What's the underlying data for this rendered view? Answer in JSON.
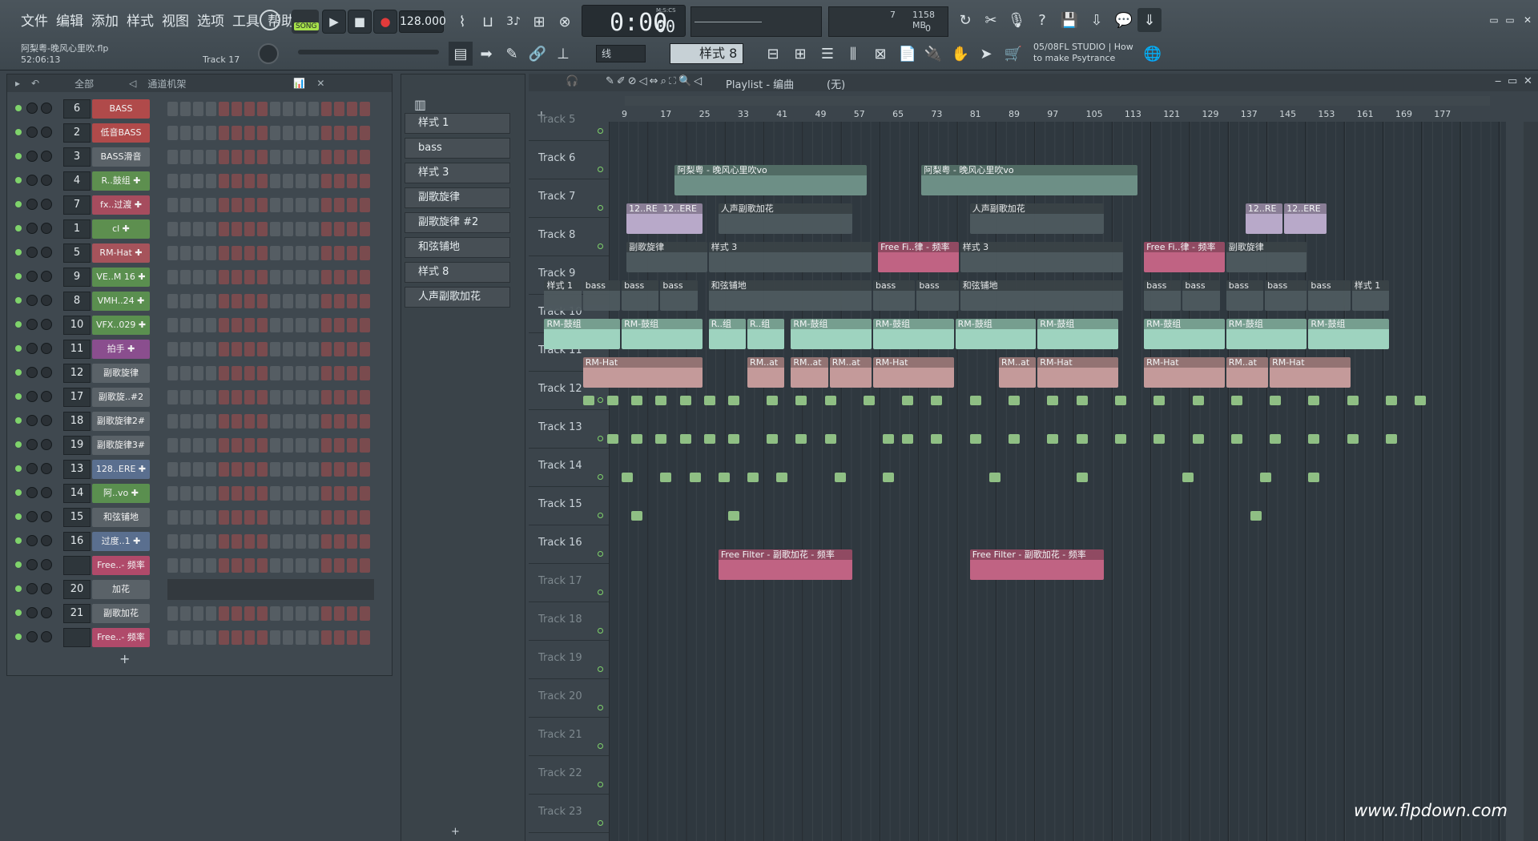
{
  "menu": [
    "文件",
    "编辑",
    "添加",
    "样式",
    "视图",
    "选项",
    "工具",
    "帮助"
  ],
  "song_mode": "SONG",
  "tempo": "128.000",
  "time": "0:00",
  "time_sub": "00",
  "time_unit": "M:S:CS",
  "cpu": "7",
  "ram": "1158 MB",
  "poly": "0",
  "project": {
    "file": "阿梨粤-晚风心里吹.flp",
    "time": "52:06:13",
    "track": "Track 17"
  },
  "pattern_selector": "样式 8",
  "snap": "线",
  "news": {
    "date": "05/08",
    "text1": "FL STUDIO | How",
    "text2": "to make Psytrance"
  },
  "rack": {
    "filter": "全部",
    "title": "通道机架",
    "channels": [
      {
        "num": "6",
        "name": "BASS",
        "color": "#b04a4a"
      },
      {
        "num": "2",
        "name": "低音BASS",
        "color": "#b04a4a"
      },
      {
        "num": "3",
        "name": "BASS滑音",
        "color": "#5a6268"
      },
      {
        "num": "4",
        "name": "R..鼓组 ✚",
        "color": "#5d8f4f"
      },
      {
        "num": "7",
        "name": "fx..过渡 ✚",
        "color": "#a64c5e"
      },
      {
        "num": "1",
        "name": "cl ✚",
        "color": "#5d8f4f"
      },
      {
        "num": "5",
        "name": "RM-Hat ✚",
        "color": "#a6535b"
      },
      {
        "num": "9",
        "name": "VE..M 16 ✚",
        "color": "#5a8f4f"
      },
      {
        "num": "8",
        "name": "VMH..24 ✚",
        "color": "#5a8f4f"
      },
      {
        "num": "10",
        "name": "VFX..029 ✚",
        "color": "#5a8f4f"
      },
      {
        "num": "11",
        "name": "拍手 ✚",
        "color": "#8a4e8e"
      },
      {
        "num": "12",
        "name": "副歌旋律",
        "color": "#5a6268"
      },
      {
        "num": "17",
        "name": "副歌旋..#2",
        "color": "#5a6268"
      },
      {
        "num": "18",
        "name": "副歌旋律2#",
        "color": "#5a6268"
      },
      {
        "num": "19",
        "name": "副歌旋律3#",
        "color": "#5a6268"
      },
      {
        "num": "13",
        "name": "128..ERE ✚",
        "color": "#5a6f8f"
      },
      {
        "num": "14",
        "name": "阿..vo ✚",
        "color": "#5a8f4f"
      },
      {
        "num": "15",
        "name": "和弦铺地",
        "color": "#5a6268"
      },
      {
        "num": "16",
        "name": "过度..1 ✚",
        "color": "#5a6f8f"
      },
      {
        "num": "",
        "name": "Free..- 频率",
        "color": "#b04a6a"
      },
      {
        "num": "20",
        "name": "加花",
        "color": "#5a6268"
      },
      {
        "num": "21",
        "name": "副歌加花",
        "color": "#5a6268"
      },
      {
        "num": "",
        "name": "Free..- 频率",
        "color": "#b04a6a"
      }
    ]
  },
  "patterns": [
    "样式 1",
    "bass",
    "样式 3",
    "副歌旋律",
    "副歌旋律 #2",
    "和弦铺地",
    "样式 8",
    "人声副歌加花"
  ],
  "playlist": {
    "title": "Playlist - 编曲",
    "sub": "(无)",
    "ruler": [
      "9",
      "17",
      "25",
      "33",
      "41",
      "49",
      "57",
      "65",
      "73",
      "81",
      "89",
      "97",
      "105",
      "113",
      "121",
      "129",
      "137",
      "145",
      "153",
      "161",
      "169",
      "177"
    ],
    "tracks": [
      "Track 5",
      "Track 6",
      "Track 7",
      "Track 8",
      "Track 9",
      "Track 10",
      "Track 11",
      "Track 12",
      "Track 13",
      "Track 14",
      "Track 15",
      "Track 16",
      "Track 17",
      "Track 18",
      "Track 19",
      "Track 20",
      "Track 21",
      "Track 22",
      "Track 23"
    ]
  },
  "clip_labels": {
    "vo": "阿梨粤 - 晚风心里吹vo",
    "ere": "12..RE",
    "ere2": "12..ERE",
    "vocal_fill": "人声副歌加花",
    "lead": "副歌旋律",
    "pat3": "样式 3",
    "free": "Free Fi..律 - 频率",
    "pat1": "样式 1",
    "bass": "bass",
    "chord": "和弦铺地",
    "drums": "RM-鼓组",
    "drums_short": "R..组",
    "hat": "RM-Hat",
    "hat_short": "RM..at",
    "filter": "Free Filter - 副歌加花 - 频率"
  },
  "watermark": "www.flpdown.com"
}
